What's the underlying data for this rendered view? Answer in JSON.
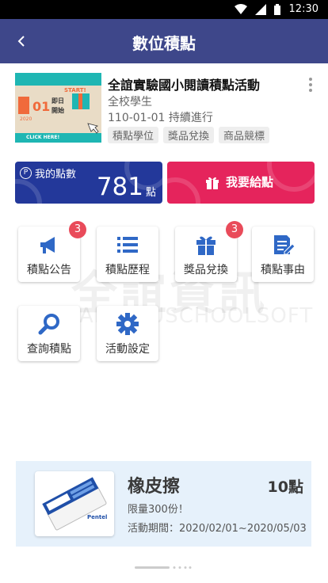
{
  "status_bar": {
    "time": "12:30"
  },
  "app_bar": {
    "title": "數位積點",
    "back_icon": "arrow-back-icon"
  },
  "activity": {
    "title": "全誼實驗國小閱讀積點活動",
    "audience": "全校學生",
    "date": "110-01-01 持續進行",
    "tags": [
      "積點學位",
      "獎品兌換",
      "商品競標"
    ],
    "banner": {
      "start_text": "START!",
      "day": "01",
      "year": "2020",
      "open_line1": "即日",
      "open_line2": "開始",
      "click": "CLICK HERE!"
    }
  },
  "points": {
    "label": "我的點數",
    "value": "781",
    "unit": "點"
  },
  "give": {
    "label": "我要給點"
  },
  "menu": [
    {
      "label": "積點公告",
      "icon": "megaphone-icon",
      "badge": "3"
    },
    {
      "label": "積點歷程",
      "icon": "list-icon",
      "badge": ""
    },
    {
      "label": "獎品兌換",
      "icon": "gift-icon",
      "badge": "3"
    },
    {
      "label": "積點事由",
      "icon": "edit-note-icon",
      "badge": ""
    },
    {
      "label": "查詢積點",
      "icon": "search-icon",
      "badge": ""
    },
    {
      "label": "活動設定",
      "icon": "gear-icon",
      "badge": ""
    }
  ],
  "watermark": {
    "zh": "全誼資訊",
    "en": "ALLEDUSCHOOLSOFT"
  },
  "prize": {
    "name": "橡皮擦",
    "points": "10點",
    "limit": "限量300份！",
    "period": "活動期間：2020/02/01~2020/05/03",
    "eraser_brand": "Pentel"
  },
  "colors": {
    "app_bar": "#3e478a",
    "points_card": "#23389a",
    "give_card": "#e5245c",
    "icon_blue": "#2f68c6",
    "badge": "#e94b5a"
  }
}
